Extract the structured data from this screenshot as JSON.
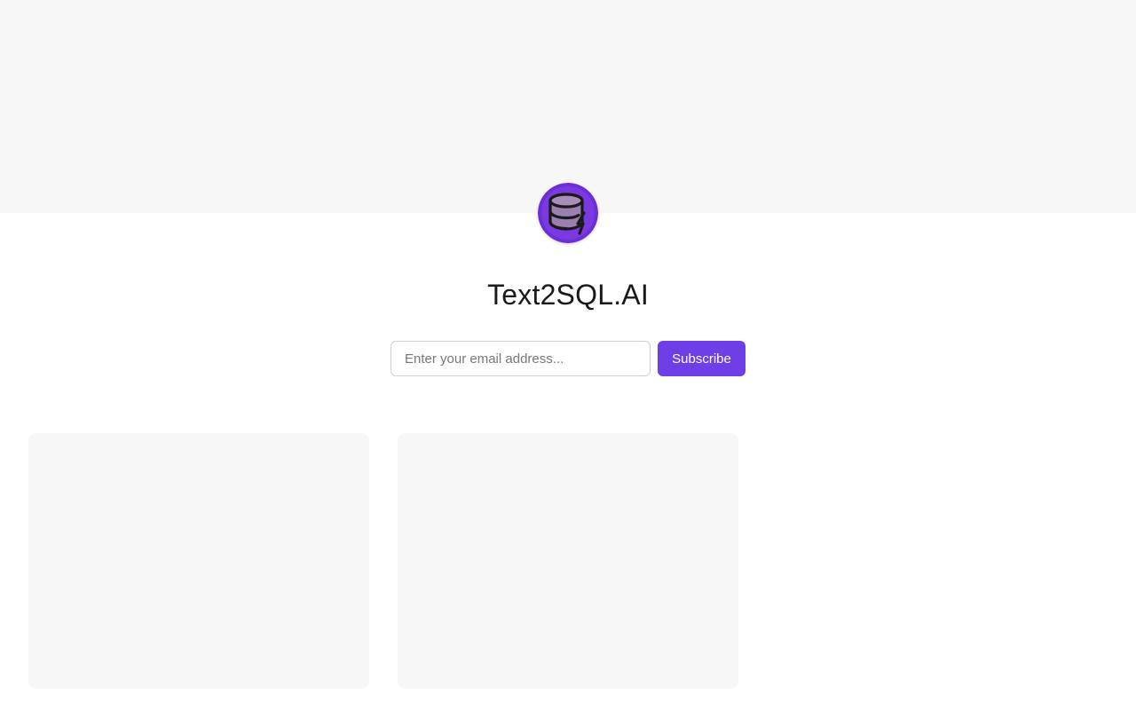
{
  "header": {
    "logo_icon": "database-lightning-icon",
    "title": "Text2SQL.AI"
  },
  "subscribe": {
    "email_placeholder": "Enter your email address...",
    "email_value": "",
    "button_label": "Subscribe"
  },
  "colors": {
    "accent": "#6e3ee6",
    "logo_bg": "#6a2fd6",
    "cover_bg": "#f7f7f7",
    "card_bg": "#f7f7f7"
  },
  "posts": [
    {
      "title": ""
    },
    {
      "title": ""
    }
  ]
}
